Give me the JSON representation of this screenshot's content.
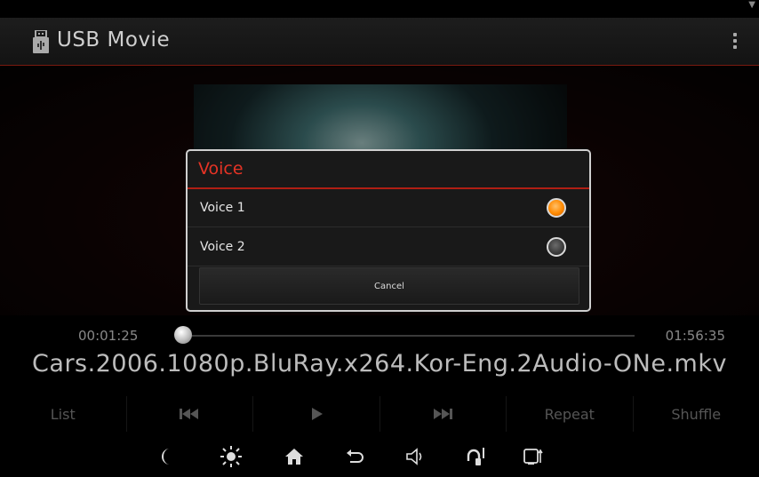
{
  "app": {
    "title": "USB Movie"
  },
  "dialog": {
    "title": "Voice",
    "options": [
      {
        "label": "Voice 1",
        "selected": true
      },
      {
        "label": "Voice 2",
        "selected": false
      }
    ],
    "cancel_label": "Cancel"
  },
  "player": {
    "current_time": "00:01:25",
    "total_time": "01:56:35",
    "position_fraction": 0.012,
    "filename": "Cars.2006.1080p.BluRay.x264.Kor-Eng.2Audio-ONe.mkv"
  },
  "controls": {
    "list_label": "List",
    "repeat_label": "Repeat",
    "shuffle_label": "Shuffle",
    "icons": [
      "previous-icon",
      "play-icon",
      "next-icon"
    ]
  },
  "system_bar": {
    "icons": [
      "night-mode-icon",
      "brightness-icon",
      "home-icon",
      "back-icon",
      "volume-icon",
      "media-icon",
      "phone-icon"
    ]
  },
  "colors": {
    "accent": "#e53325",
    "radio_selected": "#ff8a00"
  }
}
